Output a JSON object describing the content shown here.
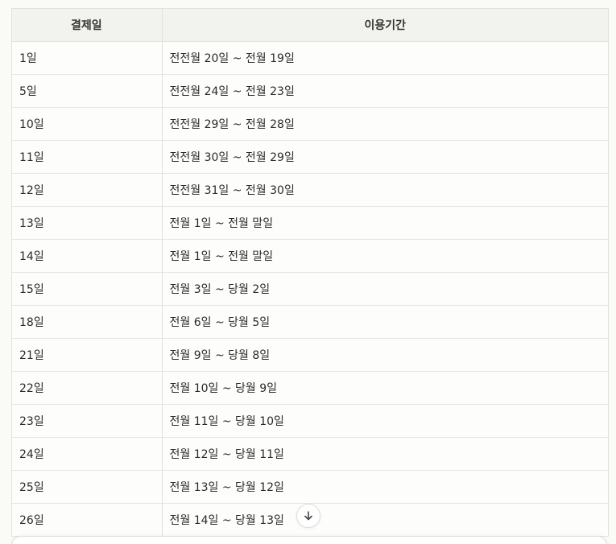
{
  "table": {
    "headers": [
      "결제일",
      "이용기간"
    ],
    "rows": [
      [
        "1일",
        "전전월 20일 ~ 전월 19일"
      ],
      [
        "5일",
        "전전월 24일 ~ 전월 23일"
      ],
      [
        "10일",
        "전전월 29일 ~ 전월 28일"
      ],
      [
        "11일",
        "전전월 30일 ~ 전월 29일"
      ],
      [
        "12일",
        "전전월 31일 ~ 전월 30일"
      ],
      [
        "13일",
        "전월 1일 ~ 전월 말일"
      ],
      [
        "14일",
        "전월 1일 ~ 전월 말일"
      ],
      [
        "15일",
        "전월 3일 ~ 당월 2일"
      ],
      [
        "18일",
        "전월 6일 ~ 당월 5일"
      ],
      [
        "21일",
        "전월 9일 ~ 당월 8일"
      ],
      [
        "22일",
        "전월 10일 ~ 당월 9일"
      ],
      [
        "23일",
        "전월 11일 ~ 당월 10일"
      ],
      [
        "24일",
        "전월 12일 ~ 당월 11일"
      ],
      [
        "25일",
        "전월 13일 ~ 당월 12일"
      ],
      [
        "26일",
        "전월 14일 ~ 당월 13일"
      ]
    ]
  },
  "controls": {
    "scroll_down_icon": "arrow-down-icon"
  }
}
